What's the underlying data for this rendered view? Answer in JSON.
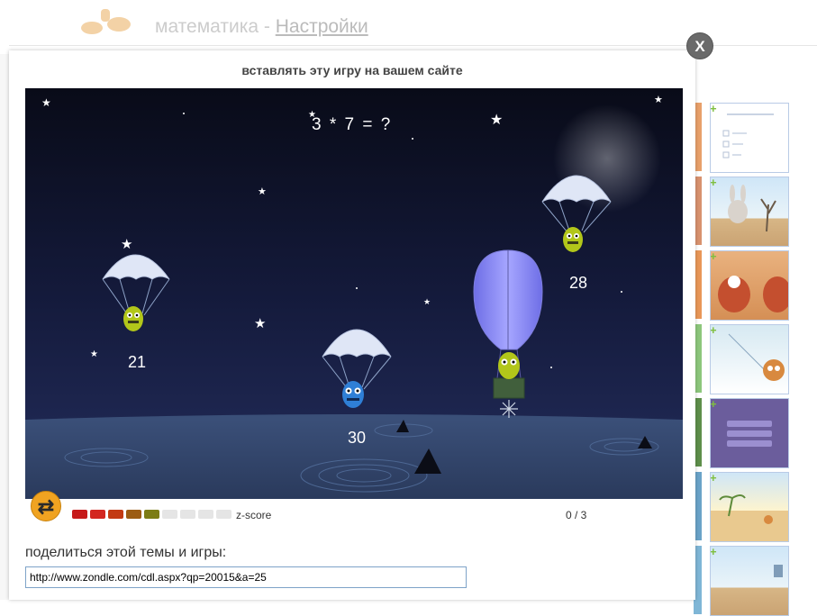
{
  "background_page": {
    "title_prefix": "математика -",
    "title_link": "Настройки"
  },
  "modal": {
    "title": "вставлять эту игру на вашем сайте",
    "close_label": "X"
  },
  "game": {
    "question": "3 * 7 = ?",
    "answers": [
      "21",
      "30",
      "28"
    ]
  },
  "controls": {
    "refresh_icon": "refresh-icon",
    "zscore_label": "z-score",
    "progress_text": "0 / 3",
    "bar_colors": [
      "#c61b1b",
      "#d3261f",
      "#c33a12",
      "#9c5c12",
      "#7c7c14",
      "#e5e5e5",
      "#e5e5e5",
      "#e5e5e5",
      "#e5e5e5"
    ]
  },
  "share": {
    "label": "поделиться этой темы и игры:",
    "url": "http://www.zondle.com/cdl.aspx?qp=20015&a=25"
  },
  "colors": {
    "accent_orange": "#f0a321",
    "night_sky": "#141a3b",
    "sea": "#2b3b60"
  }
}
